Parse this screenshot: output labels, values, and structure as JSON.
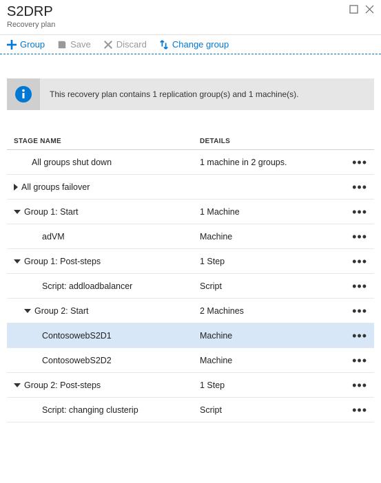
{
  "header": {
    "title": "S2DRP",
    "subtitle": "Recovery plan"
  },
  "toolbar": {
    "group": "Group",
    "save": "Save",
    "discard": "Discard",
    "change_group": "Change group"
  },
  "banner": {
    "text": "This recovery plan contains 1 replication group(s) and 1 machine(s)."
  },
  "table": {
    "header_name": "STAGE NAME",
    "header_details": "DETAILS",
    "rows": [
      {
        "name": "All groups shut down",
        "details": "1 machine in 2 groups.",
        "caret": "none",
        "indent": 1,
        "selected": false
      },
      {
        "name": "All groups failover",
        "details": "",
        "caret": "right",
        "indent": 0,
        "selected": false
      },
      {
        "name": "Group 1: Start",
        "details": "1 Machine",
        "caret": "down",
        "indent": 0,
        "selected": false
      },
      {
        "name": "adVM",
        "details": "Machine",
        "caret": "none",
        "indent": 2,
        "selected": false
      },
      {
        "name": "Group 1: Post-steps",
        "details": "1 Step",
        "caret": "down",
        "indent": 0,
        "selected": false
      },
      {
        "name": "Script: addloadbalancer",
        "details": "Script",
        "caret": "none",
        "indent": 2,
        "selected": false
      },
      {
        "name": "Group 2: Start",
        "details": "2 Machines",
        "caret": "down",
        "indent": 1,
        "selected": false
      },
      {
        "name": "ContosowebS2D1",
        "details": "Machine",
        "caret": "none",
        "indent": 2,
        "selected": true
      },
      {
        "name": "ContosowebS2D2",
        "details": "Machine",
        "caret": "none",
        "indent": 2,
        "selected": false
      },
      {
        "name": "Group 2: Post-steps",
        "details": "1 Step",
        "caret": "down",
        "indent": 0,
        "selected": false
      },
      {
        "name": "Script: changing clusterip",
        "details": "Script",
        "caret": "none",
        "indent": 2,
        "selected": false
      }
    ]
  }
}
